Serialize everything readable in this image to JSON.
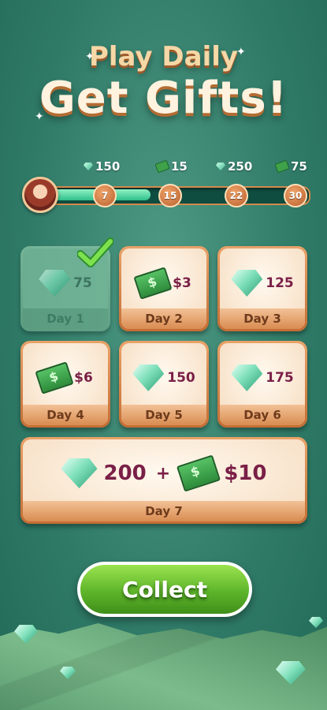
{
  "header": {
    "line1": "Play Daily",
    "line2": "Get Gifts!"
  },
  "progress": {
    "fill_fraction": 0.41,
    "rewards": [
      {
        "icon": "gem-icon",
        "amount": "150"
      },
      {
        "icon": "cash-icon",
        "amount": "15"
      },
      {
        "icon": "gem-icon",
        "amount": "250"
      },
      {
        "icon": "cash-icon",
        "amount": "75"
      }
    ],
    "milestones": [
      "7",
      "15",
      "22",
      "30"
    ]
  },
  "days": [
    {
      "label": "Day 1",
      "amount": "75",
      "icon": "gem-icon",
      "claimed": true
    },
    {
      "label": "Day 2",
      "amount": "$3",
      "icon": "cash-icon"
    },
    {
      "label": "Day 3",
      "amount": "125",
      "icon": "gem-icon"
    },
    {
      "label": "Day 4",
      "amount": "$6",
      "icon": "cash-icon"
    },
    {
      "label": "Day 5",
      "amount": "150",
      "icon": "gem-icon"
    },
    {
      "label": "Day 6",
      "amount": "175",
      "icon": "gem-icon"
    }
  ],
  "day7": {
    "label": "Day 7",
    "gems": "200",
    "plus": "+",
    "cash": "$10"
  },
  "collect_label": "Collect"
}
